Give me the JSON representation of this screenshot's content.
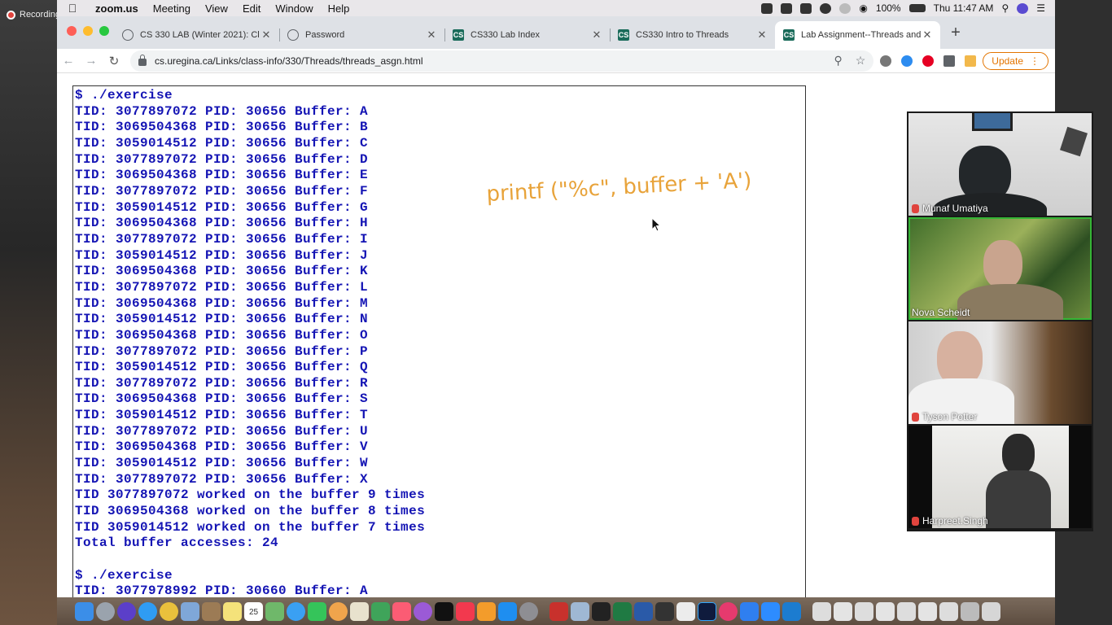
{
  "recording": {
    "label": "Recording"
  },
  "menubar": {
    "app": "zoom.us",
    "menus": [
      "Meeting",
      "View",
      "Edit",
      "Window",
      "Help"
    ],
    "battery": "100%",
    "clock": "Thu 11:47 AM"
  },
  "browser": {
    "tabs": [
      {
        "title": "CS 330 LAB (Winter 2021): Cli",
        "icon": "globe-icon"
      },
      {
        "title": "Password",
        "icon": "globe-icon"
      },
      {
        "title": "CS330 Lab Index",
        "icon": "CS"
      },
      {
        "title": "CS330 Intro to Threads",
        "icon": "CS"
      },
      {
        "title": "Lab Assignment--Threads and",
        "icon": "CS"
      }
    ],
    "url": "cs.uregina.ca/Links/class-info/330/Threads/threads_asgn.html",
    "update_label": "Update"
  },
  "terminal": {
    "lines": [
      "$ ./exercise",
      "TID: 3077897072 PID: 30656 Buffer: A",
      "TID: 3069504368 PID: 30656 Buffer: B",
      "TID: 3059014512 PID: 30656 Buffer: C",
      "TID: 3077897072 PID: 30656 Buffer: D",
      "TID: 3069504368 PID: 30656 Buffer: E",
      "TID: 3077897072 PID: 30656 Buffer: F",
      "TID: 3059014512 PID: 30656 Buffer: G",
      "TID: 3069504368 PID: 30656 Buffer: H",
      "TID: 3077897072 PID: 30656 Buffer: I",
      "TID: 3059014512 PID: 30656 Buffer: J",
      "TID: 3069504368 PID: 30656 Buffer: K",
      "TID: 3077897072 PID: 30656 Buffer: L",
      "TID: 3069504368 PID: 30656 Buffer: M",
      "TID: 3059014512 PID: 30656 Buffer: N",
      "TID: 3069504368 PID: 30656 Buffer: O",
      "TID: 3077897072 PID: 30656 Buffer: P",
      "TID: 3059014512 PID: 30656 Buffer: Q",
      "TID: 3077897072 PID: 30656 Buffer: R",
      "TID: 3069504368 PID: 30656 Buffer: S",
      "TID: 3059014512 PID: 30656 Buffer: T",
      "TID: 3077897072 PID: 30656 Buffer: U",
      "TID: 3069504368 PID: 30656 Buffer: V",
      "TID: 3059014512 PID: 30656 Buffer: W",
      "TID: 3077897072 PID: 30656 Buffer: X",
      "TID 3077897072 worked on the buffer 9 times",
      "TID 3069504368 worked on the buffer 8 times",
      "TID 3059014512 worked on the buffer 7 times",
      "Total buffer accesses: 24",
      "",
      "$ ./exercise",
      "TID: 3077978992 PID: 30660 Buffer: A"
    ]
  },
  "annotation": {
    "text": "printf (\"%c\", buffer + 'A')",
    "color": "#e8a33a"
  },
  "participants": [
    {
      "name": "Munaf Umatiya",
      "muted": true
    },
    {
      "name": "Nova Scheidt",
      "muted": false,
      "speaking": true
    },
    {
      "name": "Tyson Potter",
      "muted": true
    },
    {
      "name": "Harpreet.Singh",
      "muted": true
    }
  ],
  "dock": {
    "calendar_day": "25"
  }
}
